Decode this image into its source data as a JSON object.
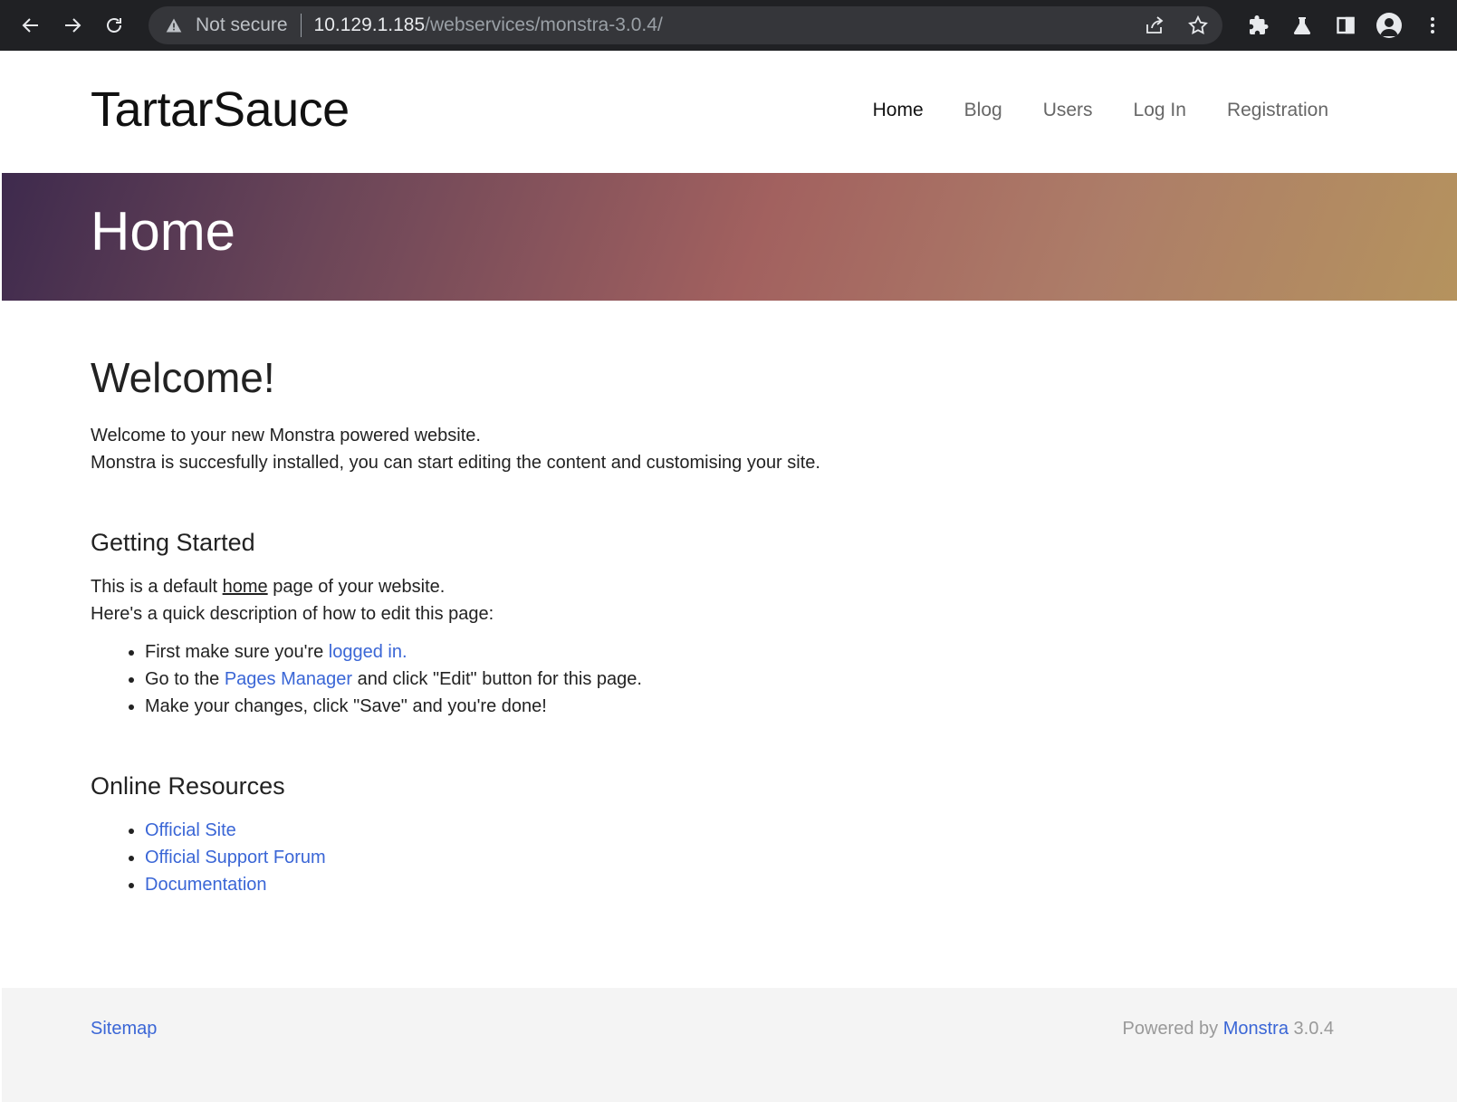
{
  "browser": {
    "security_label": "Not secure",
    "url_host": "10.129.1.185",
    "url_path": "/webservices/monstra-3.0.4/"
  },
  "site": {
    "brand": "TartarSauce",
    "menu": [
      "Home",
      "Blog",
      "Users",
      "Log In",
      "Registration"
    ]
  },
  "hero": {
    "title": "Home"
  },
  "content": {
    "welcome_heading": "Welcome!",
    "welcome_line1": "Welcome to your new Monstra powered website.",
    "welcome_line2": "Monstra is succesfully installed, you can start editing the content and customising your site.",
    "getting_started_heading": "Getting Started",
    "gs_line1_pre": "This is a default ",
    "gs_line1_link": "home",
    "gs_line1_post": " page of your website.",
    "gs_line2": "Here's a quick description of how to edit this page:",
    "steps": [
      {
        "pre": "First make sure you're ",
        "link": "logged in.",
        "post": ""
      },
      {
        "pre": "Go to the ",
        "link": "Pages Manager",
        "post": " and click \"Edit\" button for this page."
      },
      {
        "pre": "Make your changes, click \"Save\" and you're done!",
        "link": "",
        "post": ""
      }
    ],
    "resources_heading": "Online Resources",
    "resources": [
      "Official Site",
      "Official Support Forum",
      "Documentation"
    ]
  },
  "footer": {
    "sitemap": "Sitemap",
    "powered_pre": "Powered by ",
    "powered_link": "Monstra",
    "powered_version": " 3.0.4"
  }
}
